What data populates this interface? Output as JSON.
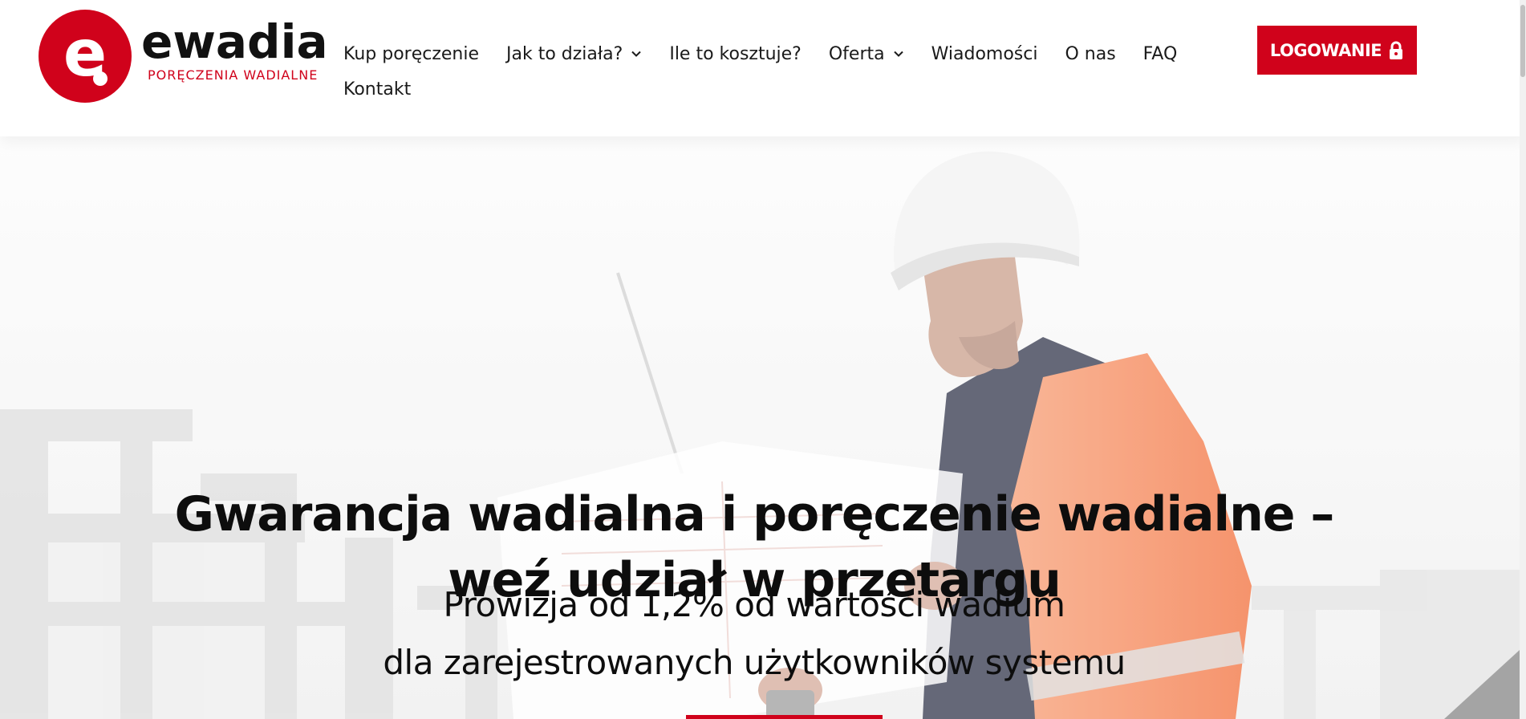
{
  "logo": {
    "wordmark": "ewadia",
    "tagline": "PORĘCZENIA WADIALNE",
    "mark_letter": "e",
    "brand_color": "#d0021b"
  },
  "nav": {
    "row1": [
      {
        "label": "Kup poręczenie",
        "dropdown": false
      },
      {
        "label": "Jak to działa?",
        "dropdown": true
      },
      {
        "label": "Ile to kosztuje?",
        "dropdown": false
      },
      {
        "label": "Oferta",
        "dropdown": true
      },
      {
        "label": "Wiadomości",
        "dropdown": false
      },
      {
        "label": "O nas",
        "dropdown": false
      },
      {
        "label": "FAQ",
        "dropdown": false
      }
    ],
    "row2": [
      {
        "label": "Kontakt",
        "dropdown": false
      }
    ]
  },
  "login": {
    "label": "LOGOWANIE",
    "icon": "lock-icon",
    "color": "#d0021b"
  },
  "hero": {
    "title": "Gwarancja wadialna i poręczenie wadialne – weź udział w przetargu",
    "sub_line1": "Prowizja od 1,2% od wartości wadium",
    "sub_line2": "dla zarejestrowanych użytkowników systemu"
  }
}
